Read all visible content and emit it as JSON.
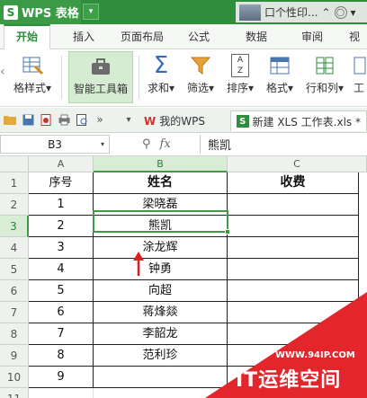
{
  "titlebar": {
    "app_name": "WPS 表格",
    "logo_char": "S",
    "app_menu_arrow": "▾",
    "user_text": "口个性印...",
    "user_icons": [
      "⌃",
      "◯",
      "▾"
    ]
  },
  "menu_tabs": [
    "开始",
    "插入",
    "页面布局",
    "公式",
    "数据",
    "审阅",
    "视"
  ],
  "ribbon": {
    "cell_style": "格样式",
    "smart_toolbox": "智能工具箱",
    "sum": "求和",
    "filter": "筛选",
    "sort": "排序",
    "format": "格式",
    "rows_cols": "行和列",
    "more": "工",
    "dropdown_arrow": "▾",
    "sum_glyph": "Σ",
    "sort_glyph_top": "A",
    "sort_glyph_bottom": "Z",
    "scroll_left": "‹"
  },
  "quickbar": {
    "icons": [
      "folder-icon",
      "save-icon",
      "export-pdf-icon",
      "print-icon",
      "print-preview-icon"
    ],
    "more": "»",
    "tab_list_arrow": "▾",
    "tabs": [
      {
        "icon": "W",
        "label": "我的WPS"
      },
      {
        "icon": "S",
        "label": "新建 XLS 工作表.xls *"
      }
    ]
  },
  "formula_bar": {
    "cell_ref": "B3",
    "namebox_arrow": "▾",
    "zoom_glyph": "⚲",
    "fx_label": "fx",
    "content": "熊凯"
  },
  "sheet": {
    "columns": [
      "A",
      "B",
      "C"
    ],
    "rows": [
      "1",
      "2",
      "3",
      "4",
      "5",
      "6",
      "7",
      "8",
      "9",
      "10",
      "11"
    ],
    "cells": [
      [
        "序号",
        "姓名",
        "收费"
      ],
      [
        "1",
        "梁晓磊",
        ""
      ],
      [
        "2",
        "熊凯",
        ""
      ],
      [
        "3",
        "涂龙辉",
        ""
      ],
      [
        "4",
        "钟勇",
        ""
      ],
      [
        "5",
        "向超",
        ""
      ],
      [
        "6",
        "蒋烽燚",
        ""
      ],
      [
        "7",
        "李韶龙",
        ""
      ],
      [
        "8",
        "范利珍",
        ""
      ],
      [
        "9",
        "",
        ""
      ],
      [
        "",
        "",
        ""
      ]
    ],
    "selected_cell": "B3"
  },
  "watermark": {
    "url": "WWW.94IP.COM",
    "text": "IT运维空间"
  },
  "colors": {
    "brand_green": "#2f8d3c",
    "selection_green": "#3f9b3f",
    "arrow_red": "#e02020",
    "watermark_red": "#e2262b"
  }
}
